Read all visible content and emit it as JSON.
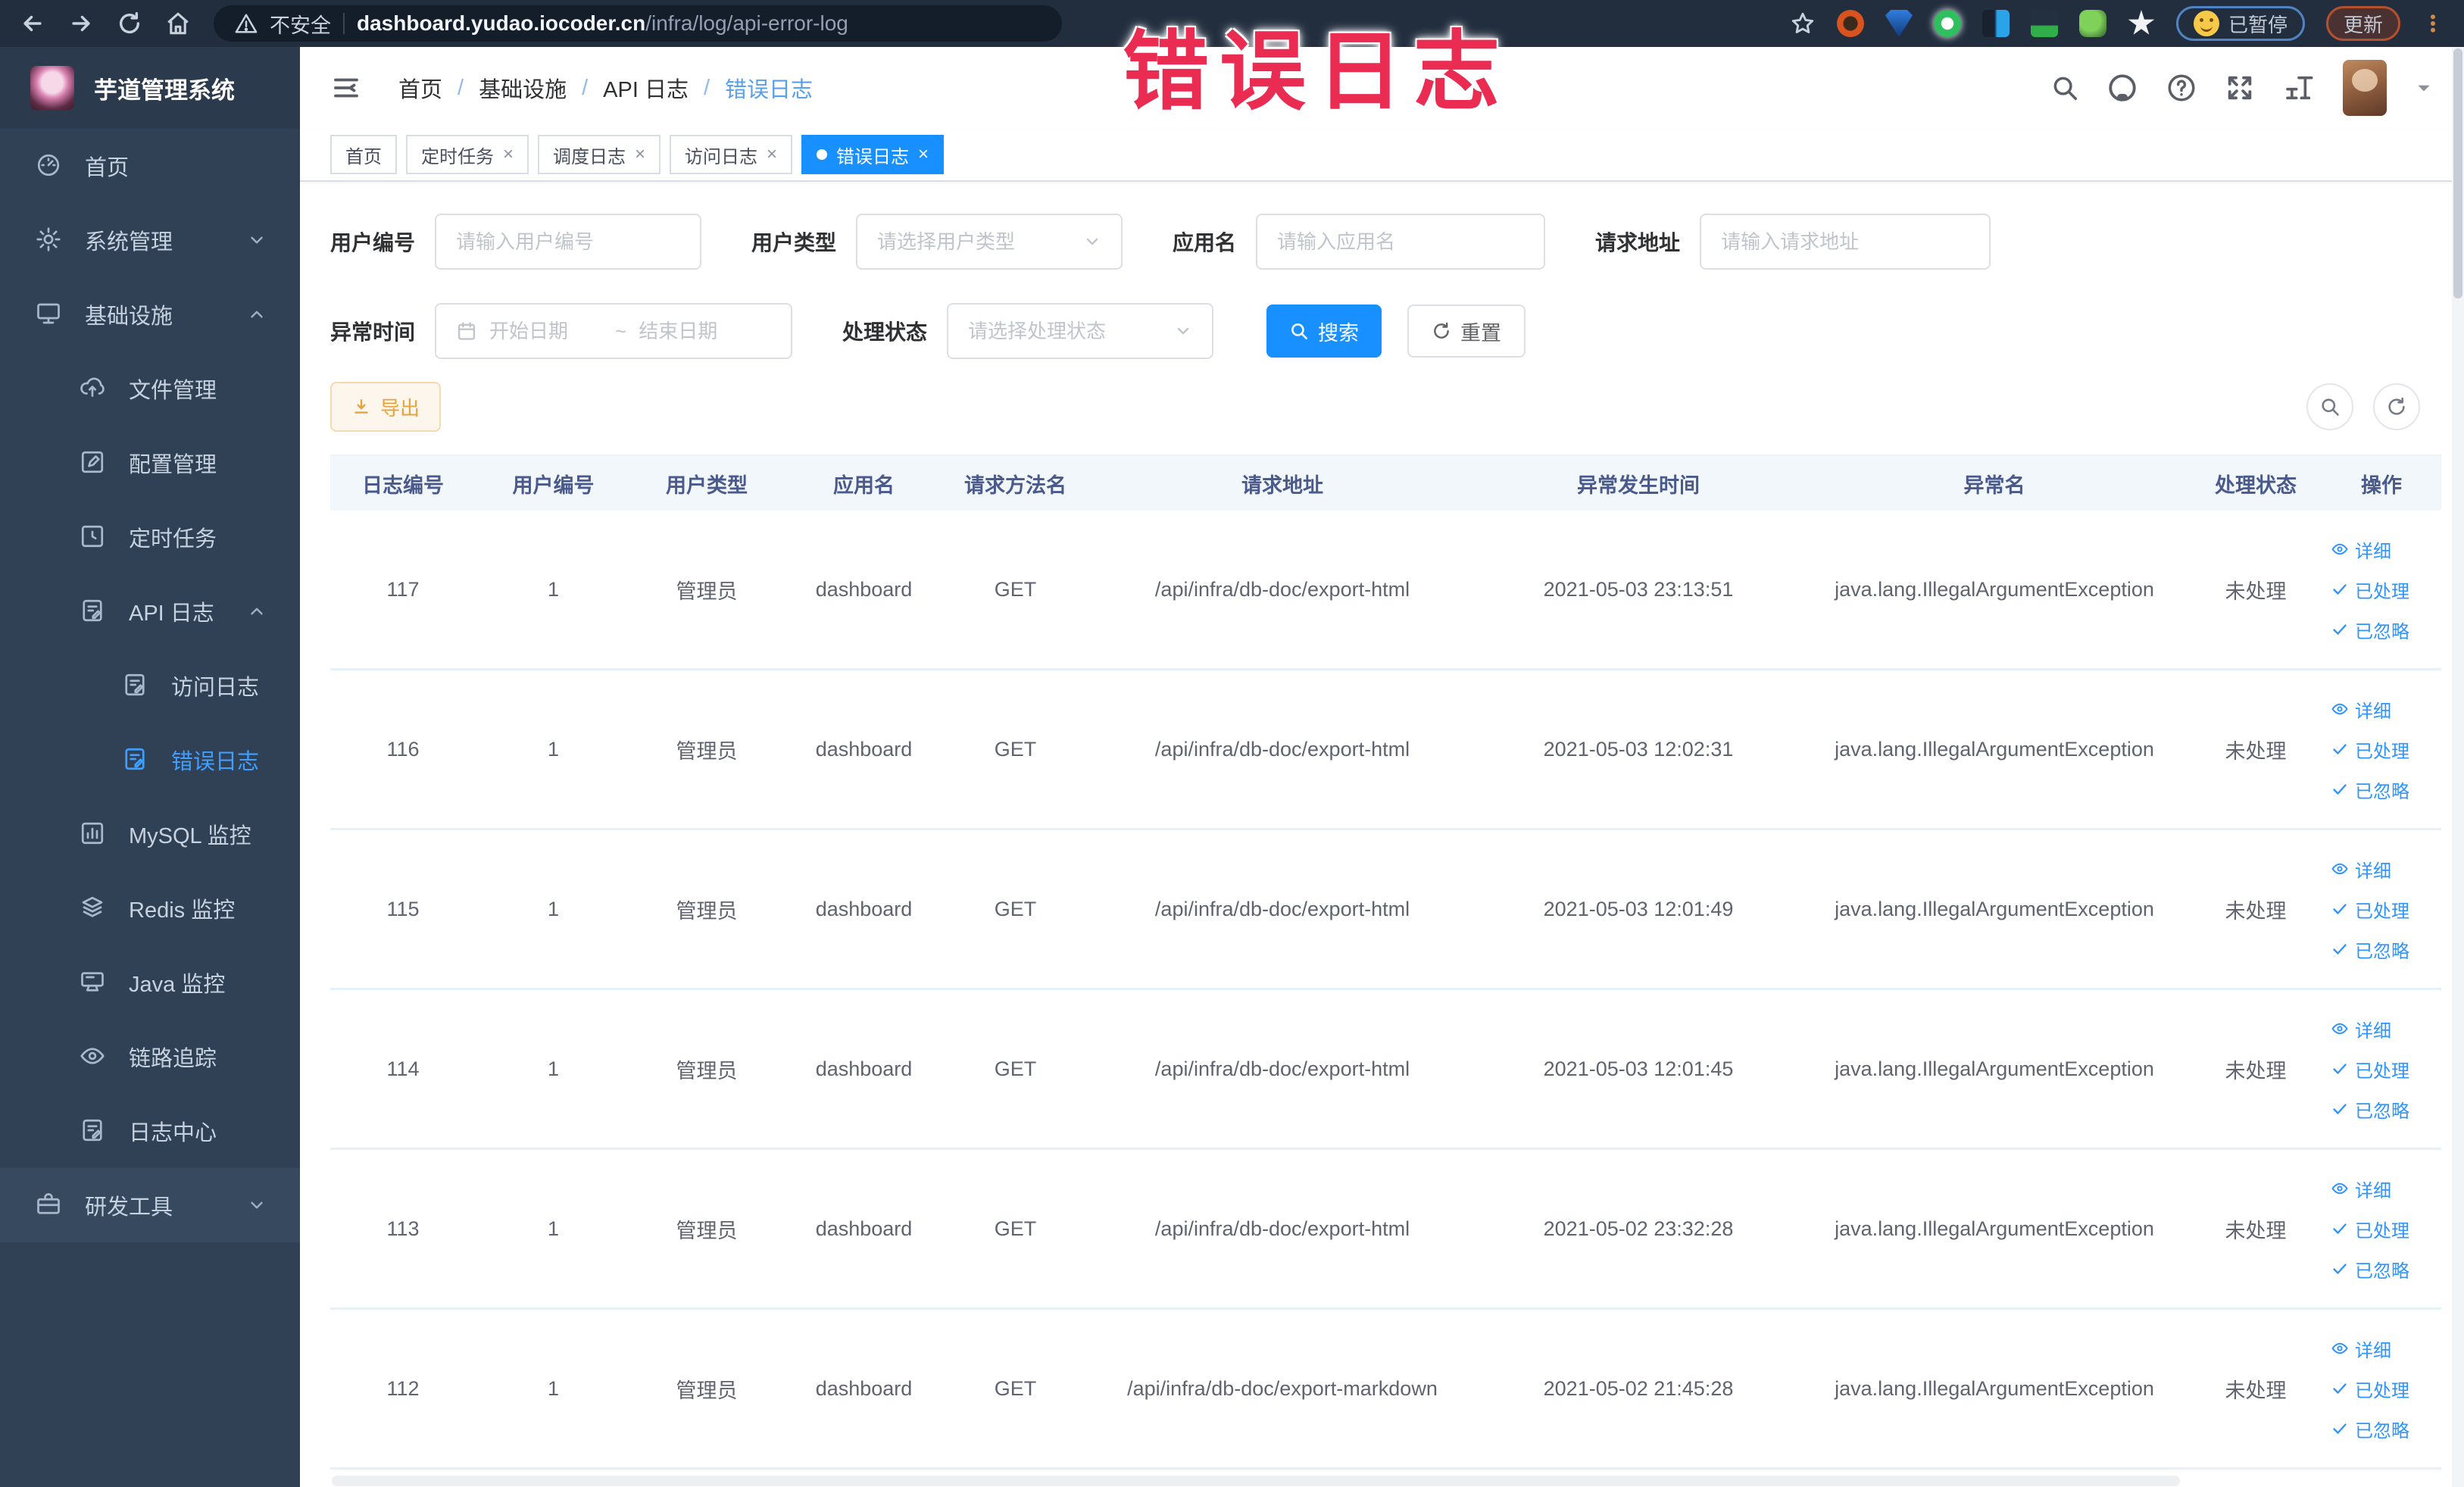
{
  "browser": {
    "security_label": "不安全",
    "url_host": "dashboard.yudao.iocoder.cn",
    "url_path": "/infra/log/api-error-log",
    "paused_badge": "已暂停",
    "update_badge": "更新"
  },
  "overlay": {
    "title": "错误日志",
    "color": "#ea2b52"
  },
  "sidebar": {
    "app_title": "芋道管理系统",
    "items": [
      {
        "key": "home",
        "label": "首页",
        "icon": "dashboard-icon",
        "level": 1
      },
      {
        "key": "system-mgmt",
        "label": "系统管理",
        "icon": "gear-icon",
        "level": 1,
        "chevron": "down"
      },
      {
        "key": "infra",
        "label": "基础设施",
        "icon": "infra-icon",
        "level": 1,
        "chevron": "up"
      },
      {
        "key": "file-mgmt",
        "label": "文件管理",
        "icon": "cloud-icon",
        "level": 2
      },
      {
        "key": "config-mgmt",
        "label": "配置管理",
        "icon": "edit-icon",
        "level": 2
      },
      {
        "key": "scheduled-job",
        "label": "定时任务",
        "icon": "clock-icon",
        "level": 2
      },
      {
        "key": "api-log",
        "label": "API 日志",
        "icon": "doc-icon",
        "level": 2,
        "chevron": "up"
      },
      {
        "key": "access-log",
        "label": "访问日志",
        "icon": "doc-icon",
        "level": 3
      },
      {
        "key": "error-log",
        "label": "错误日志",
        "icon": "doc-icon",
        "level": 3,
        "active": true
      },
      {
        "key": "mysql-monitor",
        "label": "MySQL 监控",
        "icon": "chart-icon",
        "level": 2
      },
      {
        "key": "redis-monitor",
        "label": "Redis 监控",
        "icon": "layers-icon",
        "level": 2
      },
      {
        "key": "java-monitor",
        "label": "Java 监控",
        "icon": "monitor-icon",
        "level": 2
      },
      {
        "key": "tracing",
        "label": "链路追踪",
        "icon": "eye-icon",
        "level": 2
      },
      {
        "key": "log-center",
        "label": "日志中心",
        "icon": "doc-icon",
        "level": 2
      },
      {
        "key": "dev-tools",
        "label": "研发工具",
        "icon": "briefcase-icon",
        "level": 1,
        "chevron": "down",
        "devtools": true
      }
    ]
  },
  "breadcrumb": {
    "items": [
      "首页",
      "基础设施",
      "API 日志",
      "错误日志"
    ]
  },
  "tabs": [
    {
      "key": "home",
      "label": "首页",
      "closable": false,
      "active": false
    },
    {
      "key": "job",
      "label": "定时任务",
      "closable": true,
      "active": false
    },
    {
      "key": "job-log",
      "label": "调度日志",
      "closable": true,
      "active": false
    },
    {
      "key": "access-log",
      "label": "访问日志",
      "closable": true,
      "active": false
    },
    {
      "key": "error-log",
      "label": "错误日志",
      "closable": true,
      "active": true
    }
  ],
  "filters": {
    "user_id": {
      "label": "用户编号",
      "placeholder": "请输入用户编号"
    },
    "user_type": {
      "label": "用户类型",
      "placeholder": "请选择用户类型"
    },
    "app_name": {
      "label": "应用名",
      "placeholder": "请输入应用名"
    },
    "request_url": {
      "label": "请求地址",
      "placeholder": "请输入请求地址"
    },
    "exception_time": {
      "label": "异常时间",
      "start_placeholder": "开始日期",
      "separator": "~",
      "end_placeholder": "结束日期"
    },
    "process_status": {
      "label": "处理状态",
      "placeholder": "请选择处理状态"
    },
    "search_label": "搜索",
    "reset_label": "重置"
  },
  "toolbar": {
    "export_label": "导出"
  },
  "table": {
    "columns": [
      "日志编号",
      "用户编号",
      "用户类型",
      "应用名",
      "请求方法名",
      "请求地址",
      "异常发生时间",
      "异常名",
      "处理状态",
      "操作"
    ],
    "actions": [
      "详细",
      "已处理",
      "已忽略"
    ],
    "rows": [
      {
        "id": "117",
        "user_id": "1",
        "user_type": "管理员",
        "app": "dashboard",
        "method": "GET",
        "url": "/api/infra/db-doc/export-html",
        "time": "2021-05-03 23:13:51",
        "exception": "java.lang.IllegalArgumentException",
        "status": "未处理"
      },
      {
        "id": "116",
        "user_id": "1",
        "user_type": "管理员",
        "app": "dashboard",
        "method": "GET",
        "url": "/api/infra/db-doc/export-html",
        "time": "2021-05-03 12:02:31",
        "exception": "java.lang.IllegalArgumentException",
        "status": "未处理"
      },
      {
        "id": "115",
        "user_id": "1",
        "user_type": "管理员",
        "app": "dashboard",
        "method": "GET",
        "url": "/api/infra/db-doc/export-html",
        "time": "2021-05-03 12:01:49",
        "exception": "java.lang.IllegalArgumentException",
        "status": "未处理"
      },
      {
        "id": "114",
        "user_id": "1",
        "user_type": "管理员",
        "app": "dashboard",
        "method": "GET",
        "url": "/api/infra/db-doc/export-html",
        "time": "2021-05-03 12:01:45",
        "exception": "java.lang.IllegalArgumentException",
        "status": "未处理"
      },
      {
        "id": "113",
        "user_id": "1",
        "user_type": "管理员",
        "app": "dashboard",
        "method": "GET",
        "url": "/api/infra/db-doc/export-html",
        "time": "2021-05-02 23:32:28",
        "exception": "java.lang.IllegalArgumentException",
        "status": "未处理"
      },
      {
        "id": "112",
        "user_id": "1",
        "user_type": "管理员",
        "app": "dashboard",
        "method": "GET",
        "url": "/api/infra/db-doc/export-markdown",
        "time": "2021-05-02 21:45:28",
        "exception": "java.lang.IllegalArgumentException",
        "status": "未处理"
      }
    ]
  }
}
